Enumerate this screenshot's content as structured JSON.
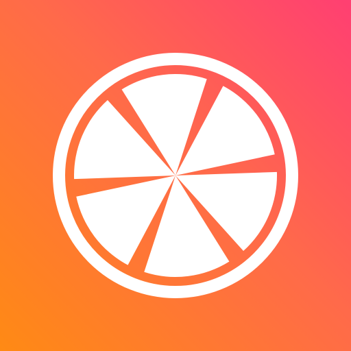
{
  "icon": {
    "name": "citrus-slice-icon",
    "gradient": {
      "top_right": "#ff3f72",
      "middle": "#ff6a4a",
      "bottom_left": "#ff8a14"
    },
    "foreground": "#ffffff",
    "segments": 6
  }
}
